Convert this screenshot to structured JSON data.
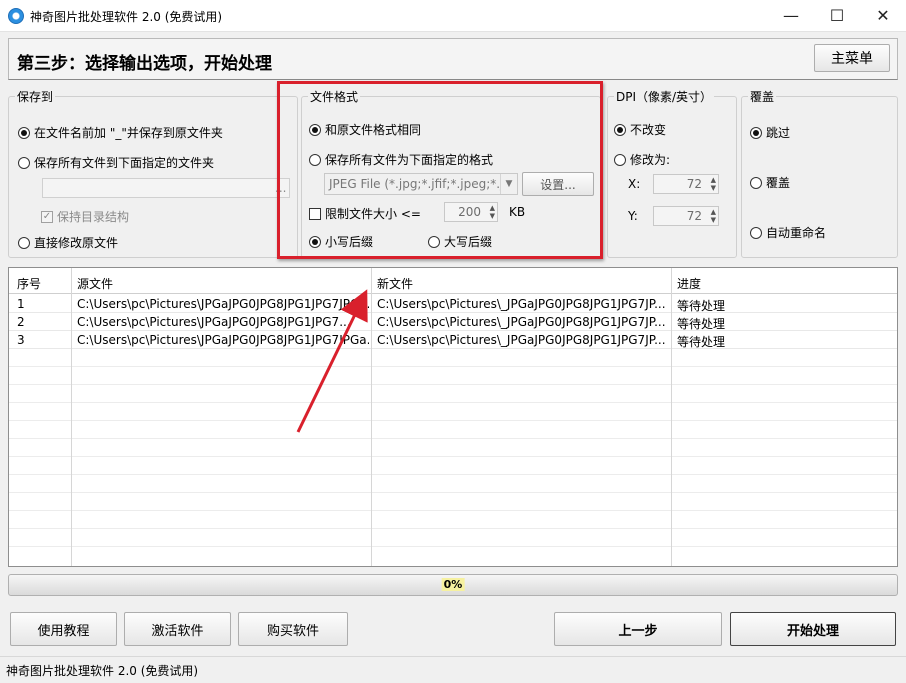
{
  "window": {
    "title": "神奇图片批处理软件 2.0 (免费试用)",
    "minimize": "—",
    "maximize": "☐",
    "close": "✕"
  },
  "header": {
    "step_title": "第三步：选择输出选项，开始处理",
    "main_menu": "主菜单"
  },
  "save_to": {
    "title": "保存到",
    "opt_prefix": "在文件名前加 \"_\"并保存到原文件夹",
    "opt_folder": "保存所有文件到下面指定的文件夹",
    "folder_value": "",
    "browse": "...",
    "keep_structure": "保持目录结构",
    "opt_overwrite": "直接修改原文件",
    "selected": "prefix"
  },
  "file_format": {
    "title": "文件格式",
    "opt_same": "和原文件格式相同",
    "opt_specify": "保存所有文件为下面指定的格式",
    "format_value": "JPEG File (*.jpg;*.jfif;*.jpeg;*.jpe)",
    "settings": "设置...",
    "limit_size": "限制文件大小 <=",
    "size_value": "200",
    "size_unit": "KB",
    "lower_ext": "小写后缀",
    "upper_ext": "大写后缀",
    "selected": "same",
    "ext_selected": "lower"
  },
  "dpi": {
    "title": "DPI（像素/英寸）",
    "opt_keep": "不改变",
    "opt_change": "修改为:",
    "x_label": "X:",
    "x_value": "72",
    "y_label": "Y:",
    "y_value": "72",
    "selected": "keep"
  },
  "overwrite": {
    "title": "覆盖",
    "opt_skip": "跳过",
    "opt_overwrite": "覆盖",
    "opt_rename": "自动重命名",
    "selected": "skip"
  },
  "table": {
    "headers": [
      "序号",
      "源文件",
      "新文件",
      "进度"
    ],
    "rows": [
      [
        "1",
        "C:\\Users\\pc\\Pictures\\JPGaJPG0JPG8JPG1JPG7JPGa...",
        "C:\\Users\\pc\\Pictures\\_JPGaJPG0JPG8JPG1JPG7JP...",
        "等待处理"
      ],
      [
        "2",
        "C:\\Users\\pc\\Pictures\\JPGaJPG0JPG8JPG1JPG7...",
        "C:\\Users\\pc\\Pictures\\_JPGaJPG0JPG8JPG1JPG7JP...",
        "等待处理"
      ],
      [
        "3",
        "C:\\Users\\pc\\Pictures\\JPGaJPG0JPG8JPG1JPG7JPGa...",
        "C:\\Users\\pc\\Pictures\\_JPGaJPG0JPG8JPG1JPG7JP...",
        "等待处理"
      ]
    ]
  },
  "progress": {
    "label": "0%",
    "value": 0
  },
  "buttons": {
    "tutorial": "使用教程",
    "activate": "激活软件",
    "buy": "购买软件",
    "prev": "上一步",
    "start": "开始处理"
  },
  "status": {
    "text": "神奇图片批处理软件 2.0 (免费试用)"
  },
  "colors": {
    "highlight": "#d9202c",
    "progress_label_bg": "#f6f1a0"
  }
}
